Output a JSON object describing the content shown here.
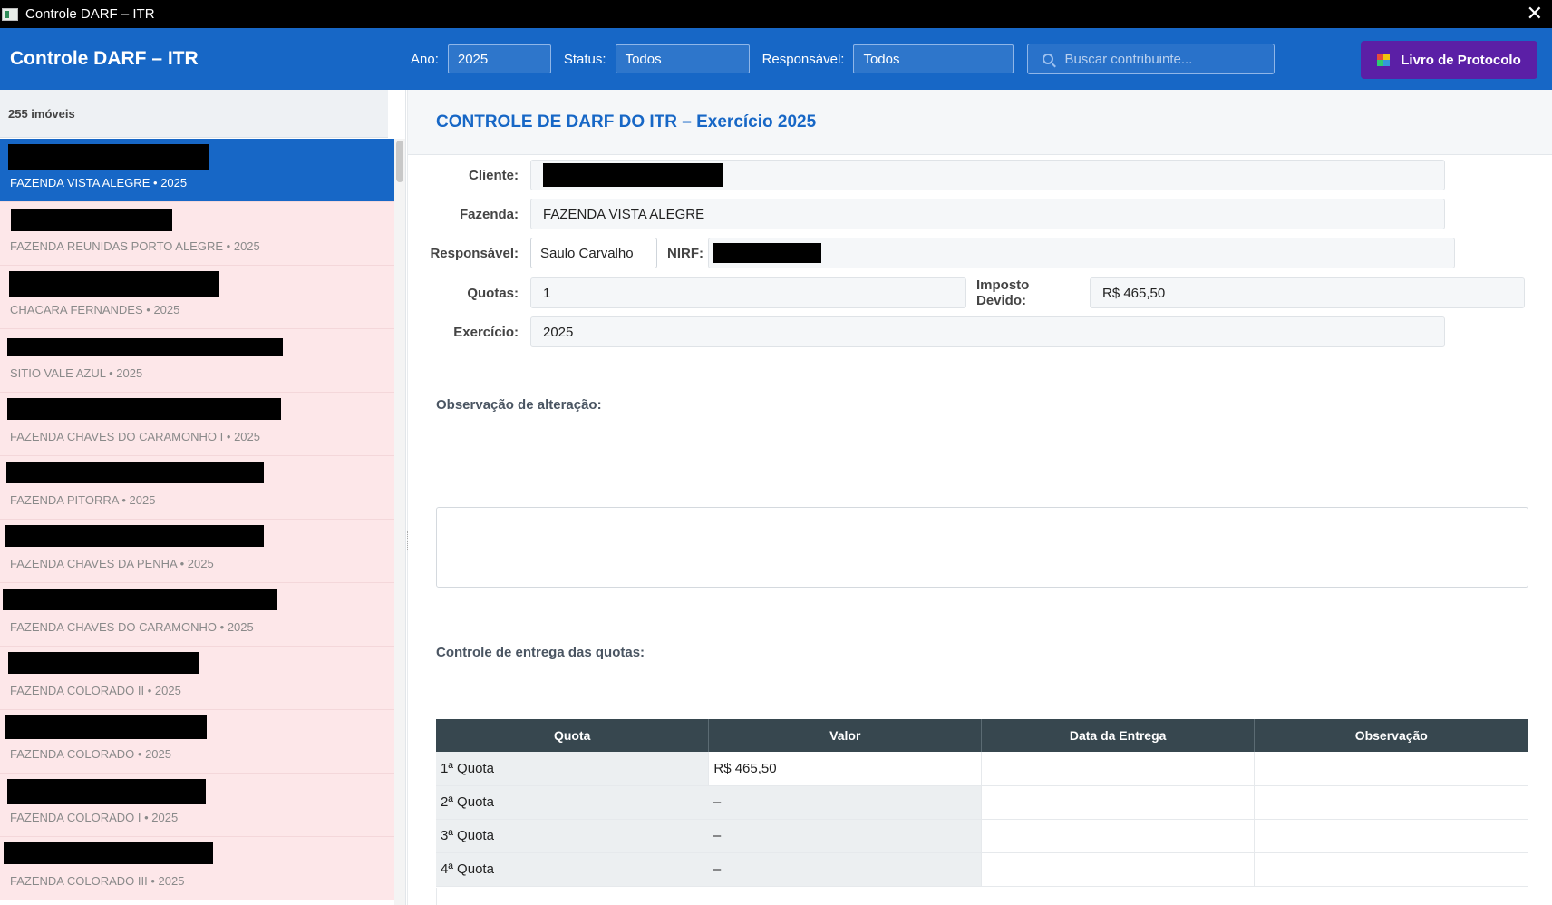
{
  "window": {
    "title": "Controle DARF – ITR"
  },
  "header": {
    "app_title": "Controle DARF – ITR",
    "ano_label": "Ano:",
    "ano_value": "2025",
    "status_label": "Status:",
    "status_value": "Todos",
    "responsavel_label": "Responsável:",
    "responsavel_value": "Todos",
    "search_placeholder": "Buscar contribuinte...",
    "protocol_button": "Livro de Protocolo"
  },
  "sidebar": {
    "count": "255 imóveis",
    "items": [
      {
        "farm": "FAZENDA VISTA ALEGRE",
        "year": "2025",
        "selected": true
      },
      {
        "farm": "FAZENDA REUNIDAS PORTO ALEGRE",
        "year": "2025"
      },
      {
        "farm": "CHACARA FERNANDES",
        "year": "2025"
      },
      {
        "farm": "SITIO VALE AZUL",
        "year": "2025"
      },
      {
        "farm": "FAZENDA CHAVES DO CARAMONHO I",
        "year": "2025"
      },
      {
        "farm": "FAZENDA PITORRA",
        "year": "2025"
      },
      {
        "farm": "FAZENDA CHAVES DA PENHA",
        "year": "2025"
      },
      {
        "farm": "FAZENDA CHAVES DO CARAMONHO",
        "year": "2025"
      },
      {
        "farm": "FAZENDA COLORADO II",
        "year": "2025"
      },
      {
        "farm": "FAZENDA COLORADO",
        "year": "2025"
      },
      {
        "farm": "FAZENDA COLORADO I",
        "year": "2025"
      },
      {
        "farm": "FAZENDA COLORADO III",
        "year": "2025"
      }
    ],
    "separator": "•"
  },
  "main": {
    "page_title": "CONTROLE DE DARF DO ITR – Exercício 2025",
    "cliente_label": "Cliente:",
    "fazenda_label": "Fazenda:",
    "fazenda_value": "FAZENDA VISTA ALEGRE",
    "responsavel_label": "Responsável:",
    "responsavel_value": "Saulo Carvalho",
    "nirf_label": "NIRF:",
    "quotas_label": "Quotas:",
    "quotas_value": "1",
    "imposto_label": "Imposto Devido:",
    "imposto_value": "R$ 465,50",
    "exercicio_label": "Exercício:",
    "exercicio_value": "2025",
    "obs_label": "Observação de alteração:",
    "controle_label": "Controle de entrega das quotas:",
    "table": {
      "headers": [
        "Quota",
        "Valor",
        "Data da Entrega",
        "Observação"
      ],
      "rows": [
        {
          "quota": "1ª Quota",
          "valor": "R$ 465,50",
          "data": "",
          "obs": ""
        },
        {
          "quota": "2ª Quota",
          "valor": "–",
          "data": "",
          "obs": ""
        },
        {
          "quota": "3ª Quota",
          "valor": "–",
          "data": "",
          "obs": ""
        },
        {
          "quota": "4ª Quota",
          "valor": "–",
          "data": "",
          "obs": ""
        }
      ]
    }
  },
  "colors": {
    "header_blue": "#1767c6",
    "protocol_purple": "#5b1fa6",
    "row_pink": "#fde7e9",
    "table_head": "#37474f"
  }
}
